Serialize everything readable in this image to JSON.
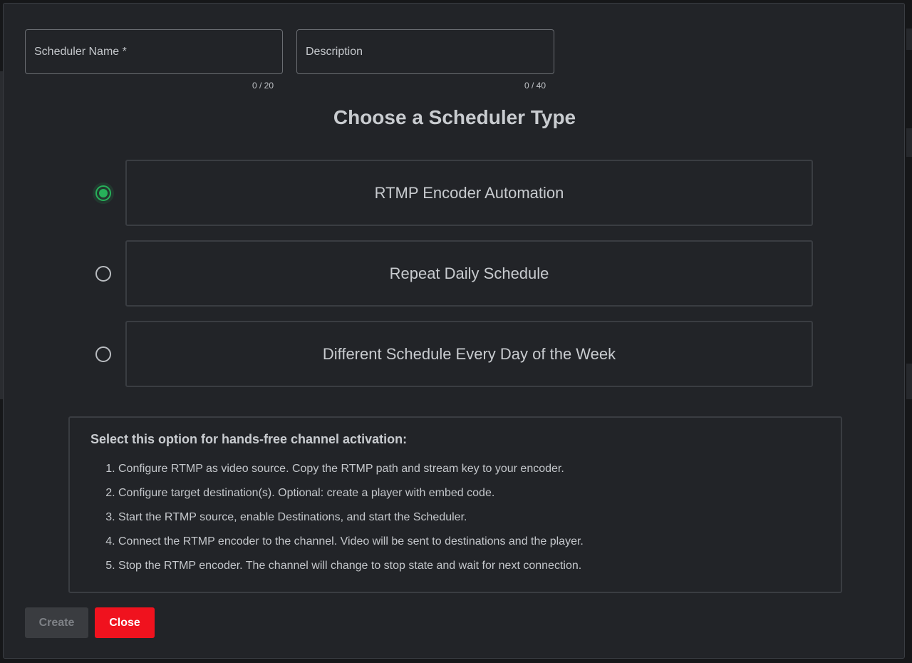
{
  "form": {
    "scheduler_name": {
      "placeholder": "Scheduler Name *",
      "value": "",
      "counter": "0 / 20"
    },
    "description": {
      "placeholder": "Description",
      "value": "",
      "counter": "0 / 40"
    }
  },
  "title": "Choose a Scheduler Type",
  "options": [
    {
      "label": "RTMP Encoder Automation",
      "selected": true
    },
    {
      "label": "Repeat Daily Schedule",
      "selected": false
    },
    {
      "label": "Different Schedule Every Day of the Week",
      "selected": false
    }
  ],
  "info": {
    "heading": "Select this option for hands-free channel activation:",
    "steps": [
      "Configure RTMP as video source. Copy the RTMP path and stream key to your encoder.",
      "Configure target destination(s). Optional: create a player with embed code.",
      "Start the RTMP source, enable Destinations, and start the Scheduler.",
      "Connect the RTMP encoder to the channel. Video will be sent to destinations and the player.",
      "Stop the RTMP encoder. The channel will change to stop state and wait for next connection."
    ]
  },
  "buttons": {
    "create": "Create",
    "close": "Close"
  },
  "colors": {
    "accent_selected": "#27b15a",
    "close_button": "#f0121e"
  }
}
